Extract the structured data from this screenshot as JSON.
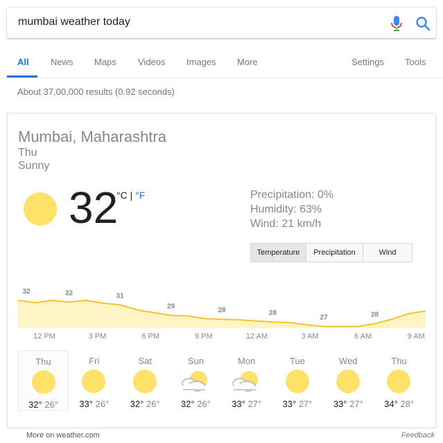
{
  "search": {
    "query": "mumbai weather today"
  },
  "tabs": [
    "All",
    "News",
    "Maps",
    "Videos",
    "Images",
    "More"
  ],
  "tools": [
    "Settings",
    "Tools"
  ],
  "stats": "About 37,00,000 results (0.92 seconds)",
  "weather": {
    "location": "Mumbai, Maharashtra",
    "day": "Thu",
    "condition": "Sunny",
    "temp": "32",
    "unit_c": "°C",
    "unit_sep": " | ",
    "unit_f": "°F",
    "precipitation": "Precipitation: 0%",
    "humidity": "Humidity: 63%",
    "wind": "Wind: 21 km/h",
    "buttons": [
      "Temperature",
      "Precipitation",
      "Wind"
    ]
  },
  "hourly": {
    "labels": [
      "32",
      "32",
      "31",
      "29",
      "28",
      "28",
      "27",
      "28"
    ],
    "values": [
      32,
      31.6,
      32,
      31.7,
      32,
      31.5,
      31.2,
      30.3,
      29.8,
      29.3,
      29.2,
      28.7,
      28.6,
      28.5,
      28.3,
      28.1,
      28.0,
      27.6,
      27.3,
      27.3,
      27.3,
      27.8,
      28.6,
      29.6,
      30.1
    ],
    "times": [
      "12 PM",
      "3 PM",
      "6 PM",
      "9 PM",
      "12 AM",
      "3 AM",
      "6 AM",
      "9 AM"
    ],
    "line_color": "#fbc02d",
    "fill_color": "#fff4c4"
  },
  "forecast": [
    {
      "day": "Thu",
      "icon": "sun",
      "hi": "32°",
      "lo": "26°"
    },
    {
      "day": "Fri",
      "icon": "sun",
      "hi": "33°",
      "lo": "26°"
    },
    {
      "day": "Sat",
      "icon": "sun",
      "hi": "32°",
      "lo": "26°"
    },
    {
      "day": "Sun",
      "icon": "partly-cloudy",
      "hi": "32°",
      "lo": "26°"
    },
    {
      "day": "Mon",
      "icon": "partly-cloudy",
      "hi": "33°",
      "lo": "27°"
    },
    {
      "day": "Tue",
      "icon": "sun",
      "hi": "33°",
      "lo": "27°"
    },
    {
      "day": "Wed",
      "icon": "sun",
      "hi": "33°",
      "lo": "27°"
    },
    {
      "day": "Thu",
      "icon": "sun",
      "hi": "34°",
      "lo": "28°"
    }
  ],
  "footer": {
    "source": "More on weather.com",
    "feedback": "Feedback"
  }
}
